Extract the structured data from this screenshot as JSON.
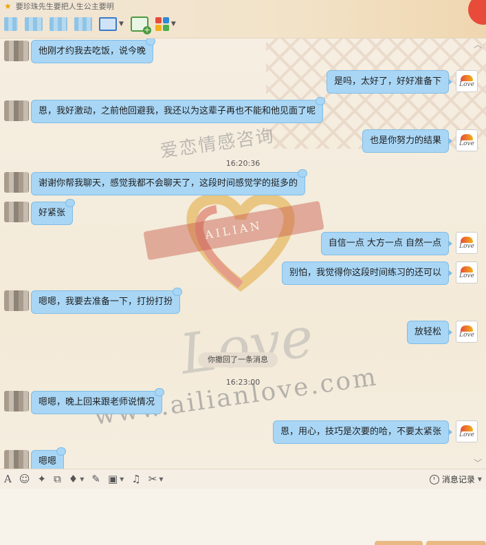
{
  "window": {
    "title": "要珍珠先生要把人生公主要明",
    "close_color": "#e84b3a"
  },
  "toolbar": {
    "icons": [
      "star-icon",
      "contact-thumb",
      "video-call-icon",
      "add-chat-icon",
      "apps-icon"
    ]
  },
  "watermark": {
    "title": "爱恋情感咨询",
    "brand": "AILIAN",
    "love": "Love",
    "url": "www.ailianlove.com"
  },
  "messages": [
    {
      "side": "left",
      "text": "他刚才约我去吃饭，说今晚"
    },
    {
      "side": "right",
      "text": "是吗，太好了，好好准备下"
    },
    {
      "side": "left",
      "text": "恩，我好激动，之前他回避我，我还以为这辈子再也不能和他见面了呢"
    },
    {
      "side": "right",
      "text": "也是你努力的结果"
    },
    {
      "side": "time",
      "text": "16:20:36"
    },
    {
      "side": "left",
      "text": "谢谢你帮我聊天，感觉我都不会聊天了，这段时间感觉学的挺多的"
    },
    {
      "side": "left",
      "text": "好紧张"
    },
    {
      "side": "right",
      "text": "自信一点 大方一点  自然一点"
    },
    {
      "side": "right",
      "text": "别怕，我觉得你这段时间练习的还可以"
    },
    {
      "side": "left",
      "text": "嗯嗯，我要去准备一下，打扮打扮"
    },
    {
      "side": "right",
      "text": "放轻松"
    },
    {
      "side": "system",
      "text": "你撤回了一条消息"
    },
    {
      "side": "time",
      "text": "16:23:00"
    },
    {
      "side": "left",
      "text": "嗯嗯，晚上回来跟老师说情况"
    },
    {
      "side": "right",
      "text": "恩，用心，技巧是次要的哈，不要太紧张"
    },
    {
      "side": "left",
      "text": "嗯嗯"
    }
  ],
  "avatar_right": {
    "label": "Love"
  },
  "input_toolbar": {
    "tools": [
      "font-icon",
      "emoji-icon",
      "magic-icon",
      "screenshot-icon",
      "voice-icon",
      "edit-icon",
      "image-icon",
      "music-icon",
      "scissors-icon"
    ],
    "history_label": "消息记录"
  },
  "colors": {
    "bubble": "#a9d6f5",
    "bubble_border": "#7fbce6",
    "background": "#f3ead8",
    "send_button": "#e8b982"
  }
}
